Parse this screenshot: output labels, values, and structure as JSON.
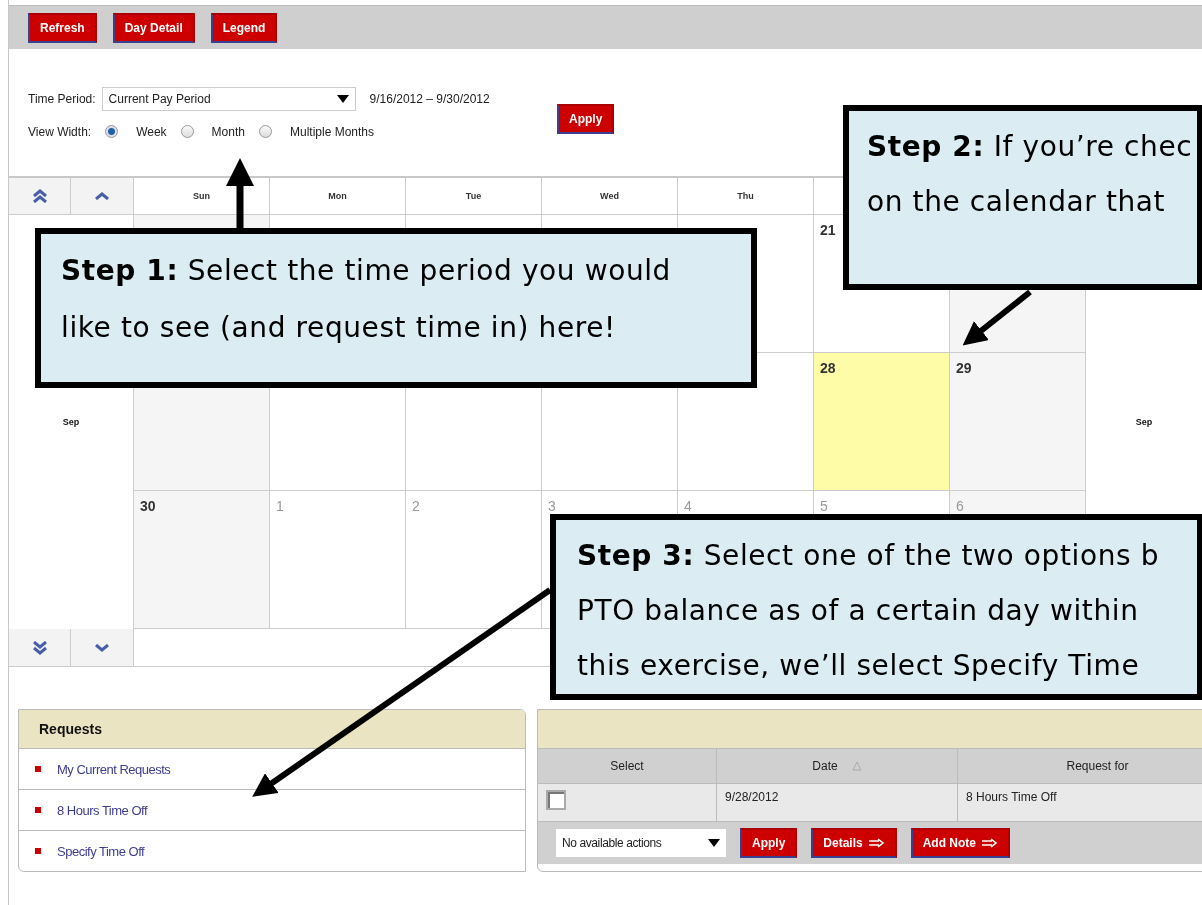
{
  "toolbar": {
    "buttons": [
      "Refresh",
      "Day Detail",
      "Legend"
    ]
  },
  "filters": {
    "time_period_label": "Time Period:",
    "time_period_value": "Current Pay Period",
    "date_range": "9/16/2012 – 9/30/2012",
    "apply": "Apply",
    "view_width_label": "View Width:",
    "view_options": [
      {
        "label": "Week",
        "selected": true
      },
      {
        "label": "Month",
        "selected": false
      },
      {
        "label": "Multiple Months",
        "selected": false
      }
    ]
  },
  "calendar": {
    "weekdays": [
      "Sun",
      "Mon",
      "Tue",
      "Wed",
      "Thu"
    ],
    "weeks": [
      {
        "days": [
          {
            "kind": "weekend"
          },
          {
            "kind": "weekday"
          },
          {
            "kind": "weekday"
          },
          {
            "kind": "weekday"
          },
          {
            "kind": "weekday"
          },
          {
            "kind": "weekday",
            "outside": false,
            "label": "21"
          },
          {
            "kind": "weekend"
          }
        ]
      },
      {
        "month_left": "Sep",
        "month_right": "Sep",
        "days": [
          {
            "kind": "weekend"
          },
          {
            "kind": "weekday"
          },
          {
            "kind": "weekday"
          },
          {
            "kind": "weekday"
          },
          {
            "kind": "weekday"
          },
          {
            "kind": "today",
            "outside": false,
            "label": "28"
          },
          {
            "kind": "weekend",
            "outside": false,
            "label": "29"
          }
        ]
      },
      {
        "days": [
          {
            "kind": "weekend",
            "outside": false,
            "label": "30"
          },
          {
            "kind": "weekday",
            "outside": true,
            "label": "1"
          },
          {
            "kind": "weekday",
            "outside": true,
            "label": "2"
          },
          {
            "kind": "weekday",
            "outside": true,
            "label": "3"
          },
          {
            "kind": "weekday",
            "outside": true,
            "label": "4"
          },
          {
            "kind": "weekday",
            "outside": true,
            "label": "5"
          },
          {
            "kind": "weekend",
            "outside": true,
            "label": "6"
          }
        ]
      }
    ]
  },
  "requests": {
    "title": "Requests",
    "items": [
      "My Current Requests",
      "8 Hours Time Off",
      "Specify Time Off"
    ]
  },
  "request_table": {
    "columns": [
      {
        "label": "Select",
        "sorted": false
      },
      {
        "label": "Date",
        "sorted": true
      },
      {
        "label": "Request for",
        "sorted": false
      }
    ],
    "rows": [
      {
        "checked": false,
        "date": "9/28/2012",
        "request_for": "8 Hours Time Off"
      }
    ],
    "action_select": "No available actions",
    "buttons": [
      {
        "label": "Apply",
        "kind": "plain"
      },
      {
        "label": "Details",
        "kind": "next"
      },
      {
        "label": "Add Note",
        "kind": "next"
      }
    ]
  },
  "callouts": [
    {
      "lines": [
        "**Step 1:** Select the time period you would",
        "like to see (and request time in) here!"
      ]
    },
    {
      "lines": [
        "**Step 2:** If you’re chec",
        "on the calendar that"
      ]
    },
    {
      "lines": [
        "**Step 3:** Select one of the two options b",
        "PTO balance as of a certain day within",
        "this exercise, we’ll select Specify Time"
      ]
    }
  ]
}
